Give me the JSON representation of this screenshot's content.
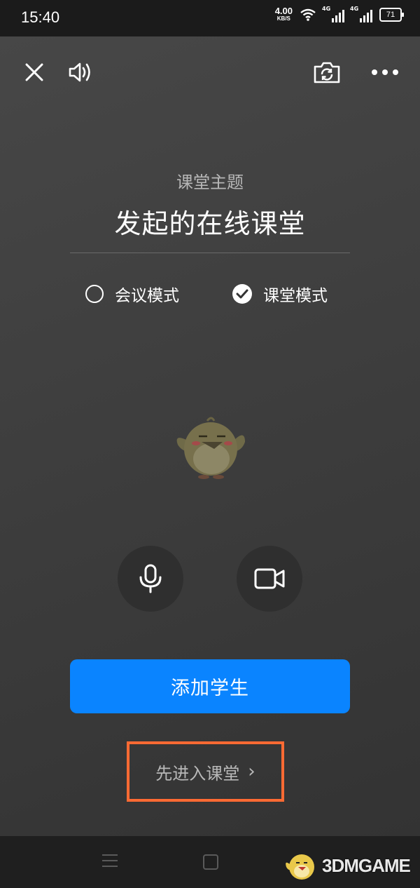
{
  "status_bar": {
    "time": "15:40",
    "net_speed_value": "4.00",
    "net_speed_unit": "KB/S",
    "signal_1_label": "4G",
    "signal_2_label": "4G",
    "battery": "71"
  },
  "toolbar": {
    "close_icon": "close-icon",
    "speaker_icon": "speaker-icon",
    "camera_switch_icon": "camera-switch-icon",
    "more_icon": "more-icon"
  },
  "topic": {
    "label": "课堂主题",
    "title": "发起的在线课堂"
  },
  "modes": {
    "meeting": {
      "label": "会议模式",
      "selected": false
    },
    "classroom": {
      "label": "课堂模式",
      "selected": true
    }
  },
  "controls": {
    "mic_icon": "microphone-icon",
    "video_icon": "video-camera-icon"
  },
  "actions": {
    "add_students": "添加学生",
    "enter_classroom": "先进入课堂",
    "enter_arrow": "›"
  },
  "colors": {
    "primary": "#0a84ff",
    "highlight_box": "#ff6a33"
  },
  "watermark": {
    "text": "3DMGAME"
  }
}
